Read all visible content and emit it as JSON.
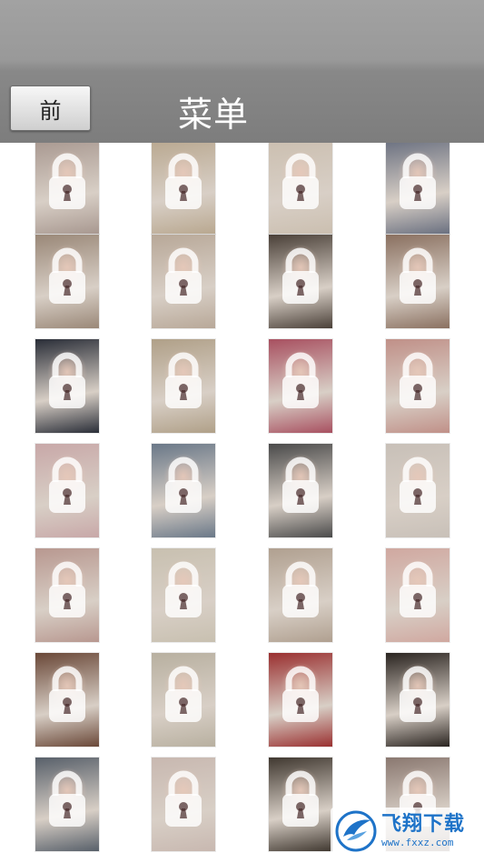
{
  "header": {
    "back_label": "前",
    "title": "菜单"
  },
  "gallery": {
    "lock_icon": "padlock-icon",
    "thumbnail_colors": [
      [
        "#a89890",
        "#b9a890",
        "#cbbfb0",
        "#6a7080"
      ],
      [
        "#9a8878",
        "#b8a898",
        "#4a4038",
        "#8a7060"
      ],
      [
        "#2a2e38",
        "#b0a088",
        "#a85060",
        "#c09088"
      ],
      [
        "#c8a8a8",
        "#6a7888",
        "#4a4a4a",
        "#c8c0b8"
      ],
      [
        "#b89890",
        "#c8c0b0",
        "#b0a090",
        "#d0a8a0"
      ],
      [
        "#6a4838",
        "#b8b0a0",
        "#9a3030",
        "#2a2420"
      ],
      [
        "#58606a",
        "#c8b8b0",
        "#403830",
        "#8a7870"
      ]
    ]
  },
  "watermark": {
    "title": "飞翔下载",
    "url": "www.fxxz.com"
  },
  "colors": {
    "topbar": "#8a8a8a",
    "watermark_blue": "#1e73c8"
  }
}
